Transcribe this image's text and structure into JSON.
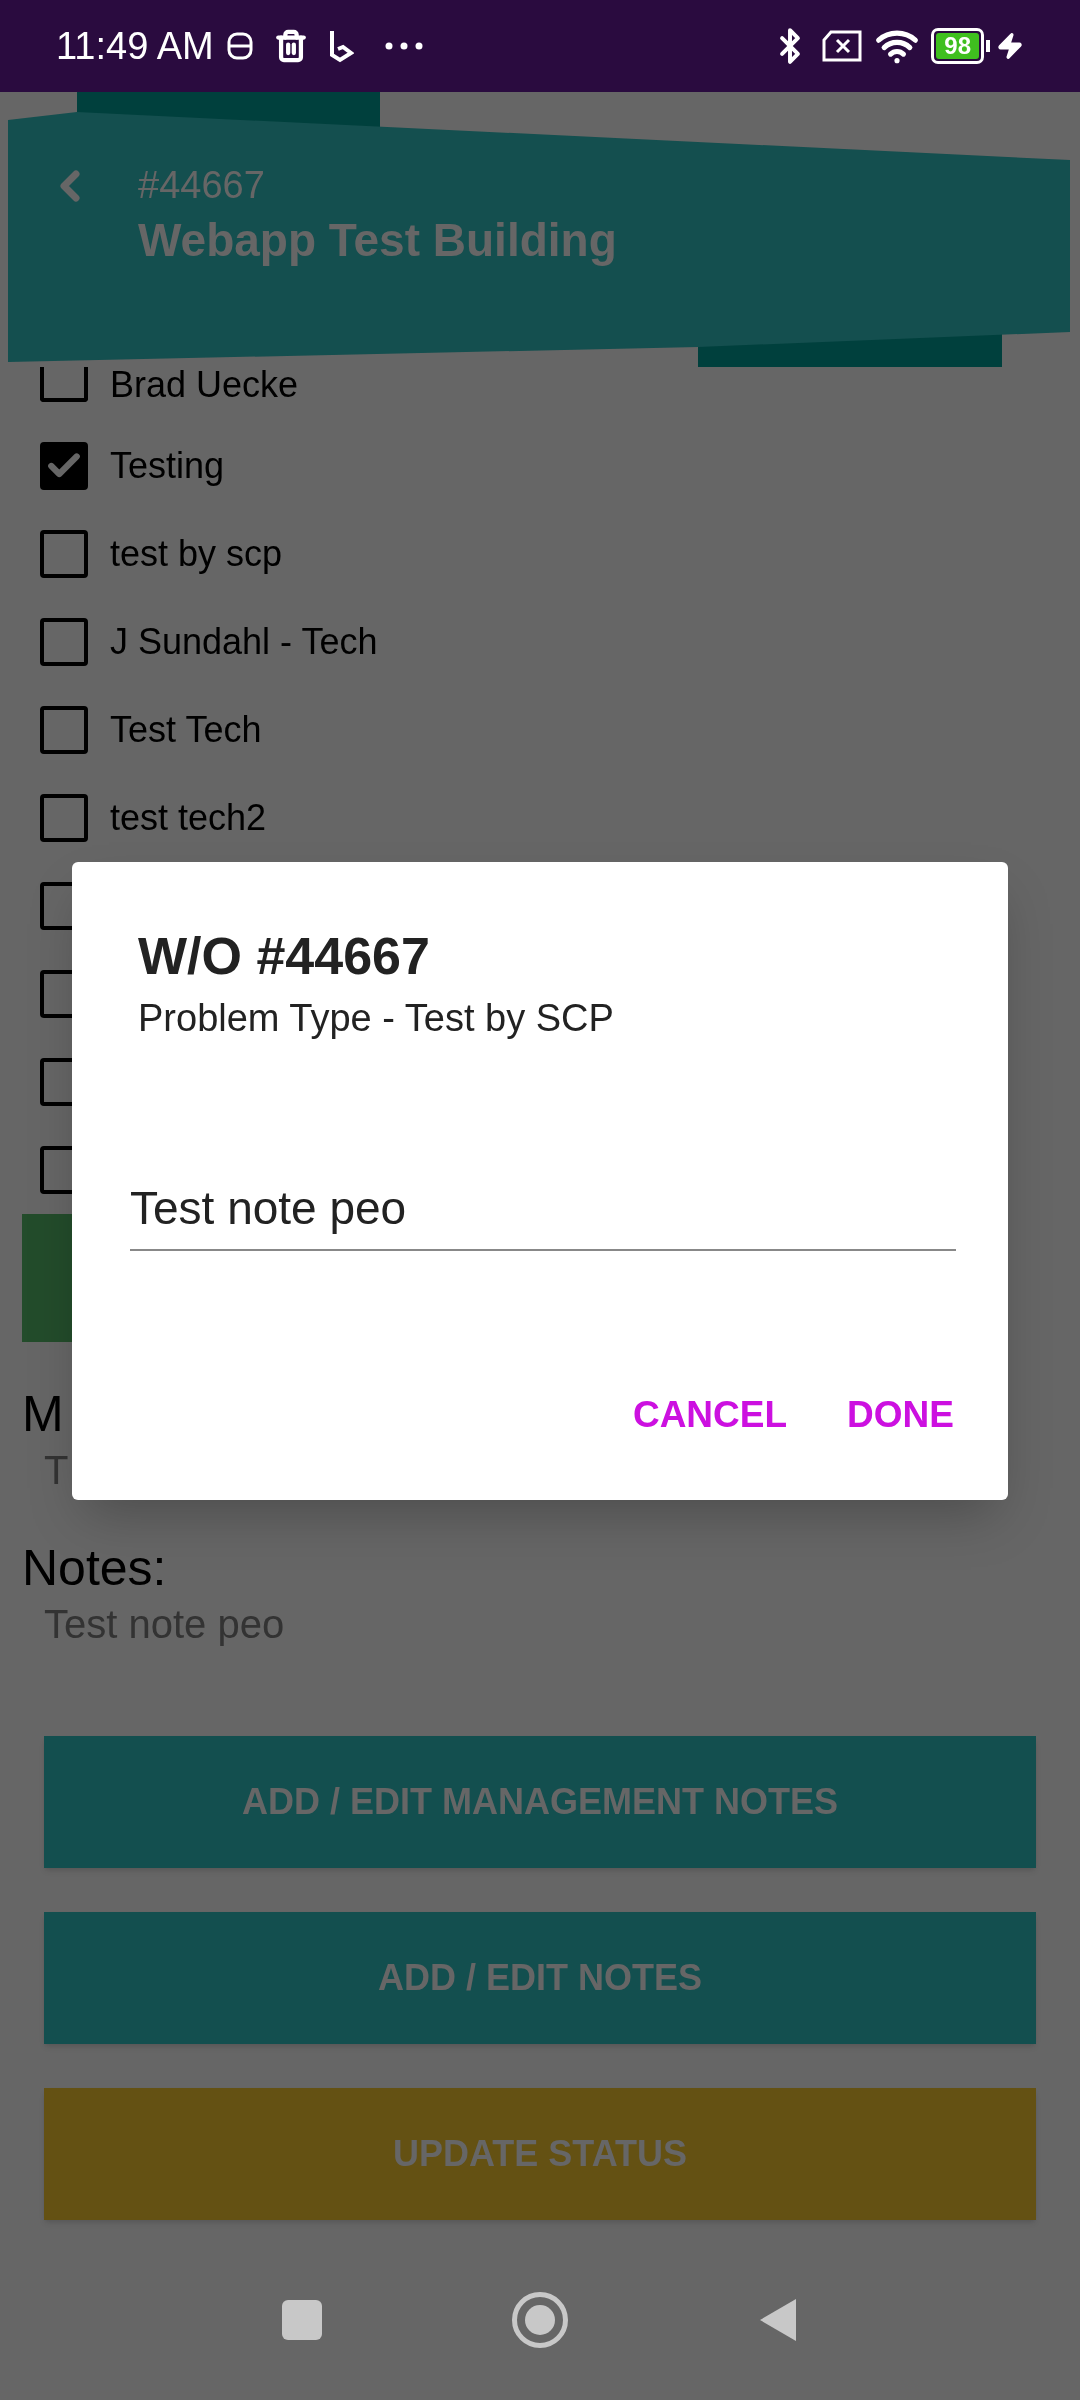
{
  "status_bar": {
    "time": "11:49 AM",
    "battery": "98"
  },
  "header": {
    "number": "#44667",
    "title": "Webapp Test Building"
  },
  "technicians": [
    {
      "label": "Brad Uecke",
      "checked": false
    },
    {
      "label": "Testing",
      "checked": true
    },
    {
      "label": "test by scp",
      "checked": false
    },
    {
      "label": "J Sundahl - Tech",
      "checked": false
    },
    {
      "label": "Test Tech",
      "checked": false
    },
    {
      "label": "test tech2",
      "checked": false
    },
    {
      "checked": false
    },
    {
      "checked": false
    },
    {
      "checked": false
    },
    {
      "checked": false
    }
  ],
  "management_notes": {
    "label": "M",
    "value": "T"
  },
  "notes": {
    "label": "Notes:",
    "value": "Test note peo"
  },
  "buttons": [
    {
      "label": "ADD / EDIT MANAGEMENT NOTES",
      "kind": "teal"
    },
    {
      "label": "ADD / EDIT NOTES",
      "kind": "teal"
    },
    {
      "label": "UPDATE STATUS",
      "kind": "amber"
    }
  ],
  "dialog": {
    "title": "W/O #44667",
    "subtitle": "Problem Type - Test by SCP",
    "value": "Test note peo",
    "actions": [
      "CANCEL",
      "DONE"
    ]
  }
}
